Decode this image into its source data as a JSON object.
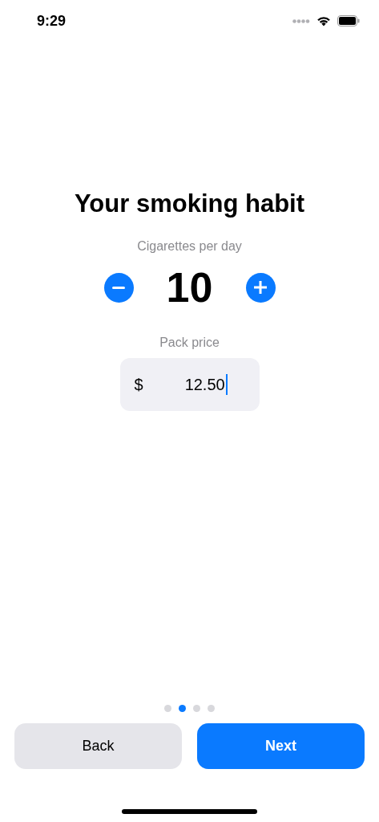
{
  "status_bar": {
    "time": "9:29"
  },
  "title": "Your smoking habit",
  "cigarettes": {
    "label": "Cigarettes per day",
    "value": "10"
  },
  "price": {
    "label": "Pack price",
    "currency": "$",
    "value": "12.50",
    "focused": true
  },
  "pages": [
    {
      "selected": false
    },
    {
      "selected": true
    },
    {
      "selected": false
    },
    {
      "selected": false
    }
  ],
  "buttons": [
    {
      "label": "Back",
      "kind": "secondary"
    },
    {
      "label": "Next",
      "kind": "primary"
    }
  ]
}
